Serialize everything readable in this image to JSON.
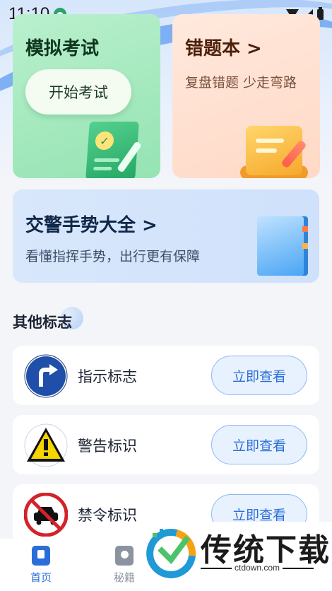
{
  "status_bar": {
    "time": "11:10"
  },
  "exam_card": {
    "title": "模拟考试",
    "button_label": "开始考试"
  },
  "wrong_card": {
    "title": "错题本 >",
    "subtitle": "复盘错题 少走弯路"
  },
  "gesture_card": {
    "title": "交警手势大全 >",
    "subtitle": "看懂指挥手势，出行更有保障"
  },
  "section": {
    "title": "其他标志"
  },
  "sign_list": [
    {
      "label": "指示标志",
      "button": "立即查看",
      "icon": "turn-right-sign-icon"
    },
    {
      "label": "警告标识",
      "button": "立即查看",
      "icon": "warning-sign-icon"
    },
    {
      "label": "禁令标识",
      "button": "立即查看",
      "icon": "no-cars-sign-icon"
    }
  ],
  "bottom_nav": [
    {
      "label": "首页",
      "icon": "home-book-icon",
      "active": true
    },
    {
      "label": "秘籍",
      "icon": "secret-book-icon",
      "active": false
    }
  ],
  "watermark": {
    "text": "传统下载",
    "site": "ctdown.com"
  },
  "colors": {
    "accent": "#2c6ed8",
    "exam_green": "#95e3b3",
    "wrong_peach": "#ffd9c6"
  }
}
